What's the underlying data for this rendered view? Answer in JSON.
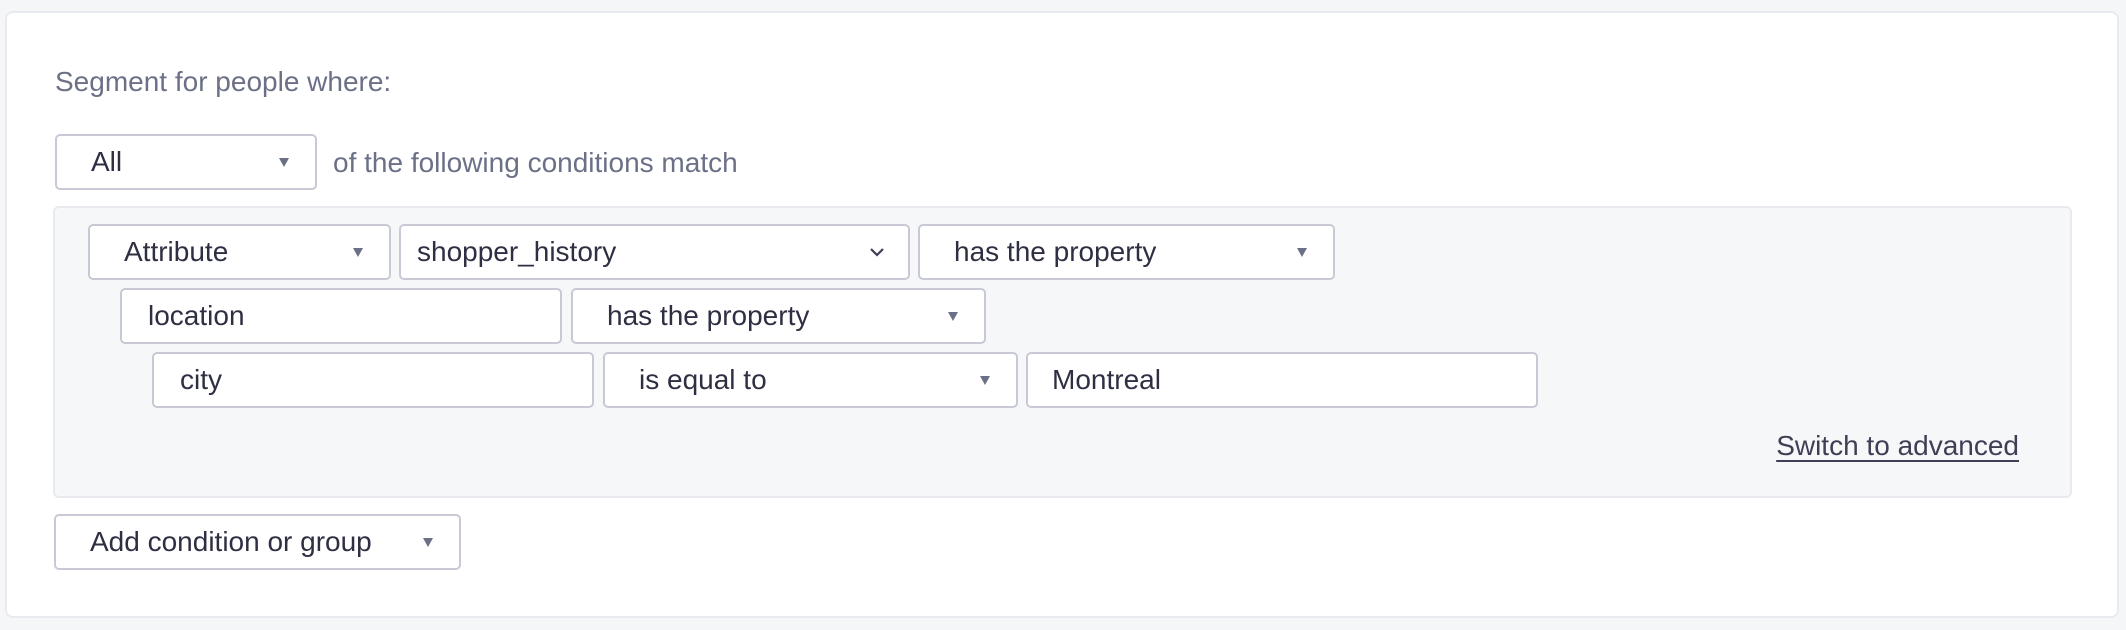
{
  "segment": {
    "heading": "Segment for people where:",
    "match_select": {
      "value": "All",
      "icon": "caret-down-icon"
    },
    "match_suffix": "of the following conditions match"
  },
  "conditions": {
    "row1": {
      "type_select": {
        "value": "Attribute",
        "icon": "caret-down-icon"
      },
      "attribute_select": {
        "value": "shopper_history",
        "icon": "chevron-down-icon"
      },
      "operator_select": {
        "value": "has the property",
        "icon": "caret-down-icon"
      }
    },
    "row2": {
      "property_input": {
        "value": "location"
      },
      "operator_select": {
        "value": "has the property",
        "icon": "caret-down-icon"
      }
    },
    "row3": {
      "property_input": {
        "value": "city"
      },
      "operator_select": {
        "value": "is equal to",
        "icon": "caret-down-icon"
      },
      "value_input": {
        "value": "Montreal"
      }
    },
    "switch_link": "Switch to advanced"
  },
  "add_button": {
    "label": "Add condition or group",
    "icon": "caret-down-icon"
  }
}
